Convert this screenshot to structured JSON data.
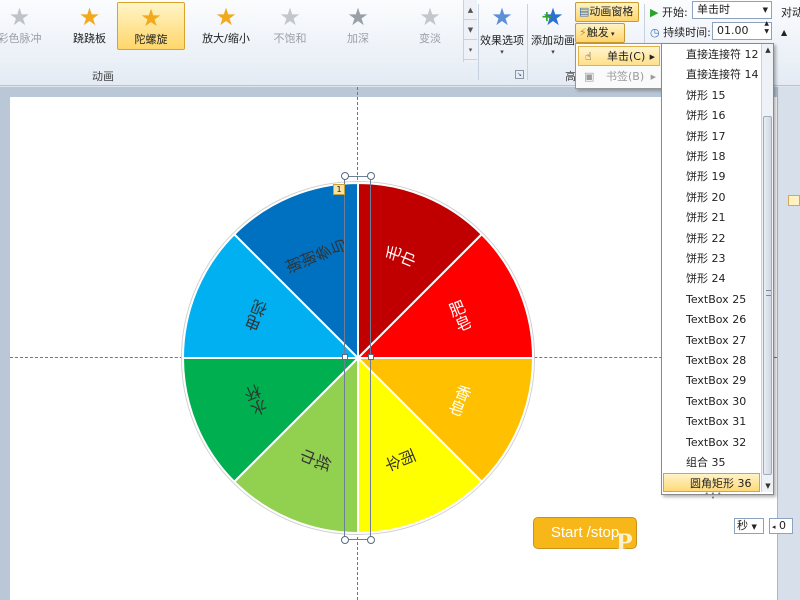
{
  "ribbon": {
    "gallery": [
      {
        "label": "彩色脉冲",
        "icon": "star-icon",
        "disabled": true
      },
      {
        "label": "跷跷板",
        "icon": "star-icon",
        "disabled": false
      },
      {
        "label": "陀螺旋",
        "icon": "star-icon",
        "disabled": false,
        "selected": true
      },
      {
        "label": "放大/缩小",
        "icon": "star-icon",
        "disabled": false
      },
      {
        "label": "不饱和",
        "icon": "star-icon",
        "disabled": true
      },
      {
        "label": "加深",
        "icon": "star-icon",
        "disabled": true
      },
      {
        "label": "变淡",
        "icon": "star-icon",
        "disabled": true
      }
    ],
    "group_animation_label": "动画",
    "effect_options_label": "效果选项",
    "add_animation_label": "添加动画",
    "advanced_group_label_partial": "高",
    "animation_pane_label": "动画窗格",
    "trigger_label": "触发",
    "start_label": "开始:",
    "start_value": "单击时",
    "duration_label": "持续时间:",
    "duration_value": "01.00",
    "align_partial": "对动"
  },
  "trigger_menu": {
    "items": [
      {
        "label": "单击(C)",
        "highlighted": true,
        "has_submenu": true
      },
      {
        "label": "书签(B)",
        "highlighted": false,
        "disabled": true,
        "has_submenu": true
      }
    ]
  },
  "object_list": {
    "items": [
      "直接连接符 12",
      "直接连接符 14",
      "饼形 15",
      "饼形 16",
      "饼形 17",
      "饼形 18",
      "饼形 19",
      "饼形 20",
      "饼形 21",
      "饼形 22",
      "饼形 23",
      "饼形 24",
      "TextBox 25",
      "TextBox 26",
      "TextBox 27",
      "TextBox 28",
      "TextBox 29",
      "TextBox 30",
      "TextBox 31",
      "TextBox 32",
      "组合 35",
      "圆角矩形 36"
    ],
    "highlighted": "圆角矩形 36"
  },
  "slide": {
    "wheel_segments": [
      {
        "label": "毛巾",
        "color": "#c00000"
      },
      {
        "label": "肥皂",
        "color": "#ff0000"
      },
      {
        "label": "香皂",
        "color": "#ffc000"
      },
      {
        "label": "雨伞",
        "color": "#ffff00"
      },
      {
        "label": "纸巾",
        "color": "#92d050"
      },
      {
        "label": "水杯",
        "color": "#00b050"
      },
      {
        "label": "电视",
        "color": "#00b0f0"
      },
      {
        "label": "谢谢参与",
        "color": "#0070c0"
      }
    ],
    "animation_order_tag": "1",
    "start_stop_button": "Start /stop",
    "watermark": "P E"
  },
  "rightpane": {
    "speed_unit": "秒",
    "speed_value": "0"
  }
}
